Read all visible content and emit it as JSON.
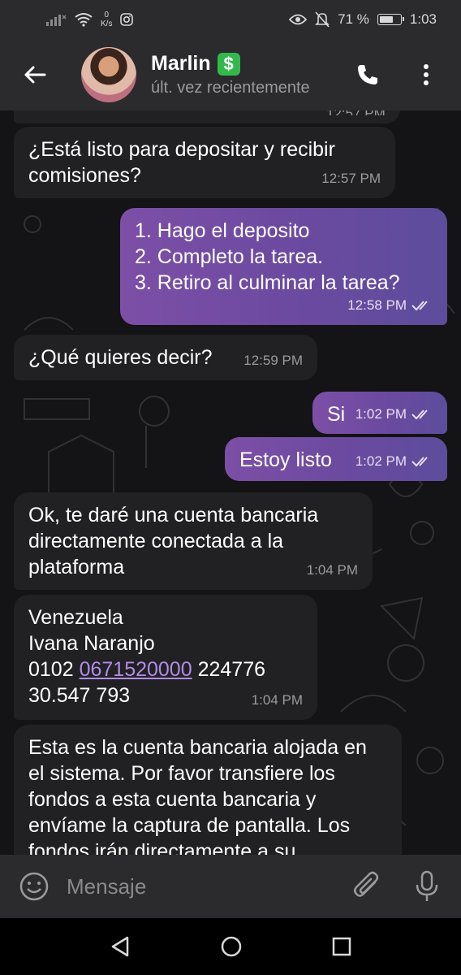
{
  "status": {
    "net_speed_value": "0",
    "net_speed_unit": "K/s",
    "battery": "71 %",
    "battery_level": 0.71,
    "time": "1:03"
  },
  "header": {
    "name": "Marlin",
    "last_seen": "últ. vez recientemente"
  },
  "messages": [
    {
      "text": "¿Está listo para depositar y recibir comisiones?",
      "time": "12:57 PM",
      "direction": "in"
    },
    {
      "lines": [
        "1. Hago el deposito",
        "2. Completo la tarea.",
        "3. Retiro al culminar la tarea?"
      ],
      "time": "12:58 PM",
      "direction": "out"
    },
    {
      "text": "¿Qué quieres decir?",
      "time": "12:59 PM",
      "direction": "in"
    },
    {
      "text": "Si",
      "time": "1:02 PM",
      "direction": "out"
    },
    {
      "text": "Estoy listo",
      "time": "1:02 PM",
      "direction": "out"
    },
    {
      "text": "Ok, te daré una cuenta bancaria directamente conectada a la plataforma",
      "time": "1:04 PM",
      "direction": "in"
    },
    {
      "country": "Venezuela",
      "holder": "Ivana Naranjo",
      "account_prefix": "0102",
      "account_link": "0671520000",
      "account_suffix": "224776",
      "id_number": "30.547 793",
      "time": "1:04 PM",
      "direction": "in"
    },
    {
      "text": "Esta es la cuenta bancaria alojada en el sistema. Por favor transfiere los fondos a esta cuenta bancaria y envíame la captura de pantalla. Los fondos irán directamente a su",
      "direction": "in"
    }
  ],
  "composer": {
    "placeholder": "Mensaje"
  },
  "colors": {
    "header_bg": "#2b2b2d",
    "chat_bg": "#141315",
    "incoming_bubble": "#212123",
    "outgoing_bubble_start": "#7d4fa7",
    "outgoing_bubble_end": "#5d4c9c",
    "link": "#b28be8",
    "badge_green": "#33b94b"
  },
  "icons": [
    "signal-icon",
    "wifi-icon",
    "instagram-icon",
    "eye-icon",
    "mute-bell-icon",
    "battery-icon",
    "back-arrow-icon",
    "phone-icon",
    "more-vertical-icon",
    "emoji-icon",
    "attach-icon",
    "mic-icon",
    "nav-back-icon",
    "nav-home-icon",
    "nav-recents-icon"
  ]
}
